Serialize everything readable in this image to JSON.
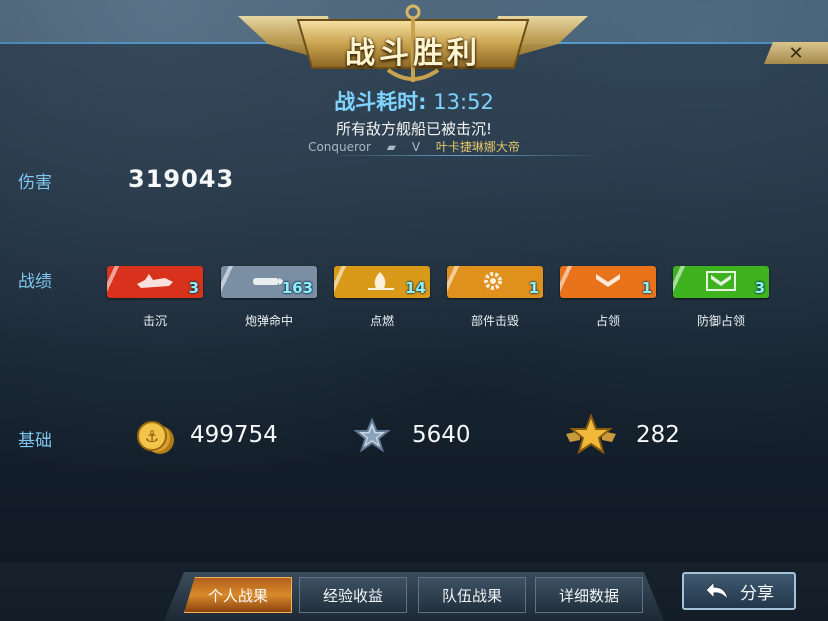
{
  "header": {
    "title": "战斗胜利",
    "duration_label": "战斗耗时:",
    "duration_value": "13:52",
    "result_text": "所有敌方舰船已被击沉!",
    "player_ship": "Conqueror",
    "vs": "V",
    "enemy_ship": "叶卡捷琳娜大帝",
    "close": "✕"
  },
  "damage": {
    "label": "伤害",
    "value": "319043"
  },
  "record": {
    "label": "战绩",
    "medals": [
      {
        "label": "击沉",
        "count": "3",
        "color": "#d8321c",
        "icon": "ship-icon"
      },
      {
        "label": "炮弹命中",
        "count": "163",
        "color": "#7a8fa3",
        "icon": "shell-icon"
      },
      {
        "label": "点燃",
        "count": "14",
        "color": "#d99a1a",
        "icon": "fire-icon"
      },
      {
        "label": "部件击毁",
        "count": "1",
        "color": "#e0901c",
        "icon": "gear-icon"
      },
      {
        "label": "占领",
        "count": "1",
        "color": "#e8731a",
        "icon": "chevron-icon"
      },
      {
        "label": "防御占领",
        "count": "3",
        "color": "#3fb21f",
        "icon": "shield-chevron-icon"
      }
    ]
  },
  "base": {
    "label": "基础",
    "coins": "499754",
    "experience": "5640",
    "rank_points": "282"
  },
  "tabs": [
    "个人战果",
    "经验收益",
    "队伍战果",
    "详细数据"
  ],
  "active_tab": "个人战果",
  "share_label": "分享"
}
